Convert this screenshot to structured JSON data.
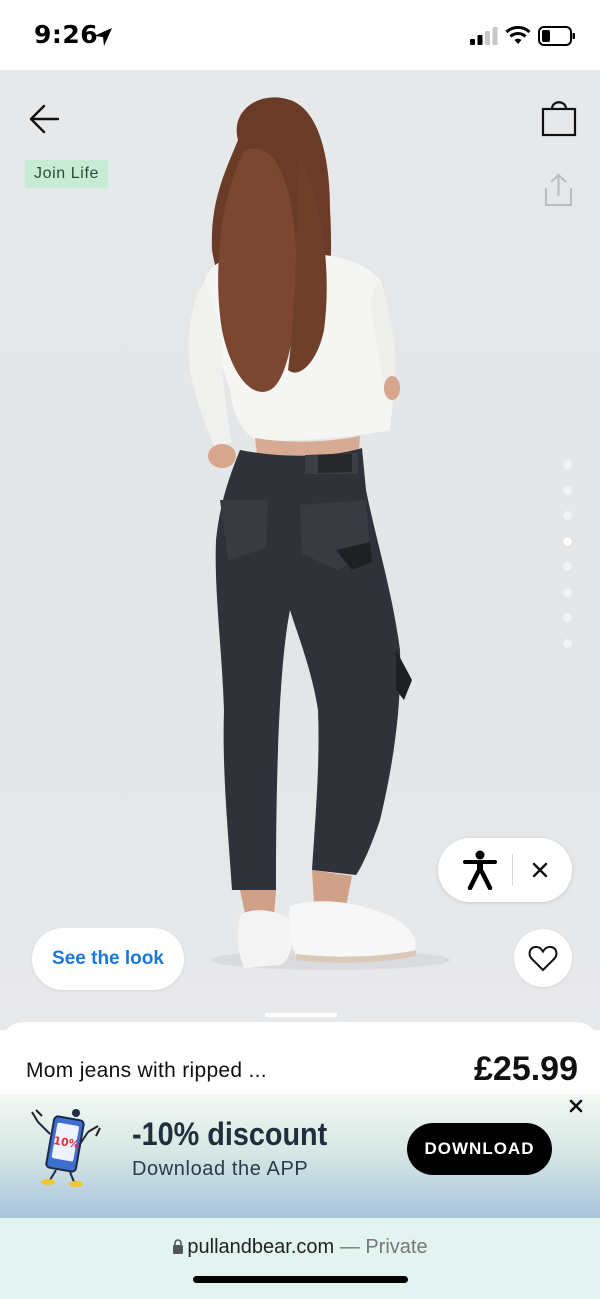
{
  "status_bar": {
    "time": "9:26",
    "icons": [
      "location-arrow-icon",
      "signal-icon",
      "wifi-icon",
      "battery-icon"
    ]
  },
  "product_hero": {
    "badge": "Join Life",
    "icons": [
      "back-arrow-icon",
      "shopping-bag-icon",
      "share-icon"
    ],
    "gallery": {
      "total_images": 8,
      "active_index": 3
    }
  },
  "accessibility_widget": {
    "icons": [
      "accessibility-person-icon",
      "close-icon"
    ]
  },
  "actions": {
    "see_look_label": "See the look",
    "wishlist_icon": "heart-icon"
  },
  "product": {
    "name": "Mom jeans with ripped ...",
    "price": "£25.99"
  },
  "app_banner": {
    "title": "-10% discount",
    "subtitle": "Download the APP",
    "button_label": "DOWNLOAD",
    "mascot_text": "10%",
    "close_icon": "close-icon"
  },
  "browser": {
    "domain": "pullandbear.com",
    "separator": " — ",
    "mode": "Private",
    "lock_icon": "lock-icon"
  },
  "colors": {
    "accent_blue": "#1a78d6",
    "badge_green": "#c7ecd5",
    "download_bg": "#000000"
  }
}
